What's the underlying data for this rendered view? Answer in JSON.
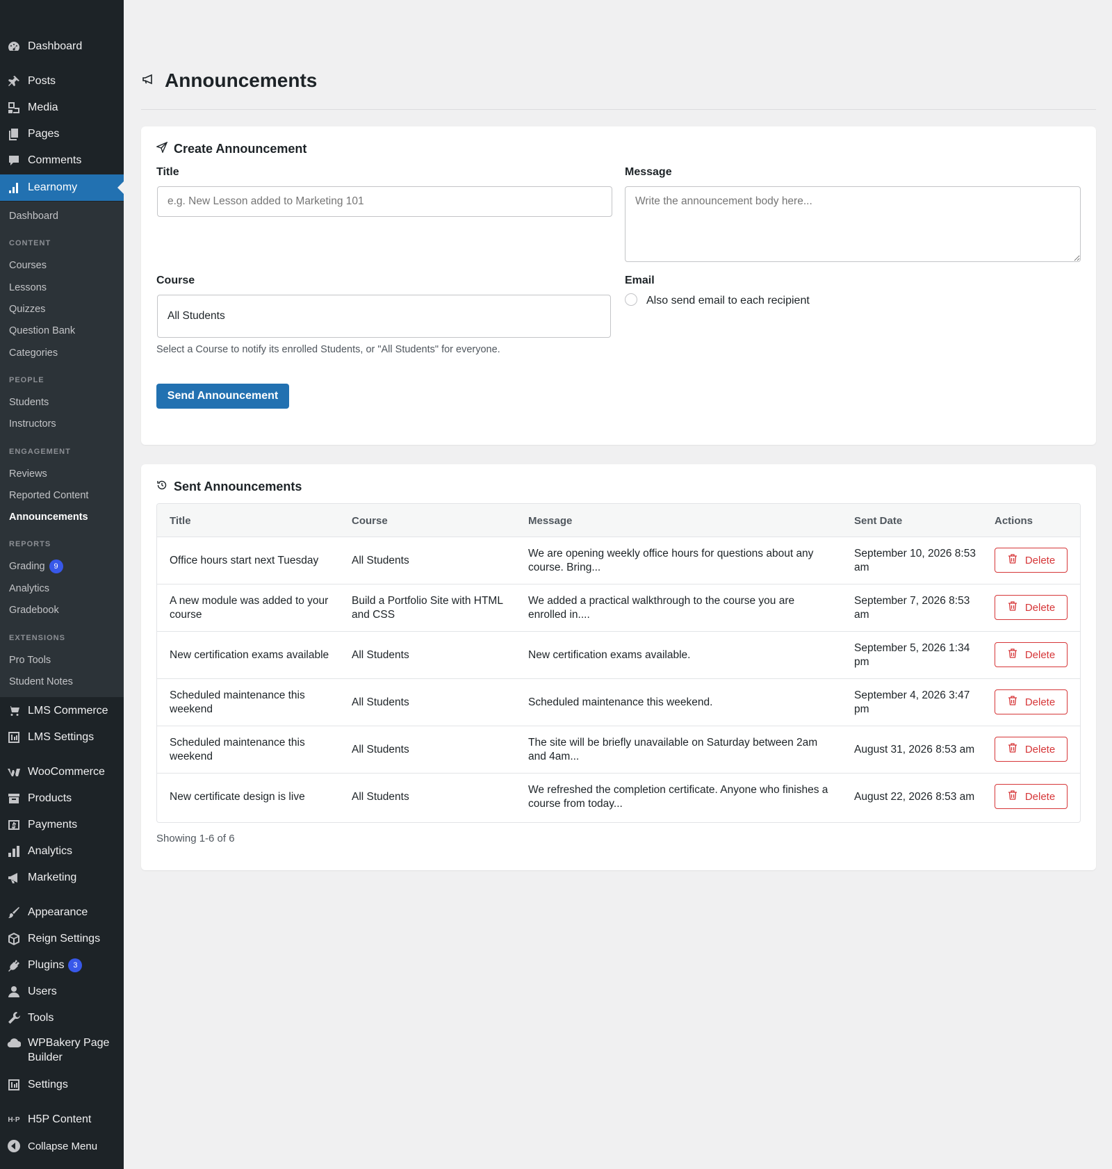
{
  "sidebar": {
    "top_items": [
      {
        "label": "Dashboard",
        "icon": "dashboard-icon"
      },
      {
        "label": "Posts",
        "icon": "pin-icon"
      },
      {
        "label": "Media",
        "icon": "media-icon"
      },
      {
        "label": "Pages",
        "icon": "pages-icon"
      },
      {
        "label": "Comments",
        "icon": "comments-icon"
      },
      {
        "label": "Learnomy",
        "icon": "chart-icon"
      }
    ],
    "submenu": {
      "dashboard": "Dashboard",
      "content_head": "CONTENT",
      "courses": "Courses",
      "lessons": "Lessons",
      "quizzes": "Quizzes",
      "question_bank": "Question Bank",
      "categories": "Categories",
      "people_head": "PEOPLE",
      "students": "Students",
      "instructors": "Instructors",
      "engagement_head": "ENGAGEMENT",
      "reviews": "Reviews",
      "reported_content": "Reported Content",
      "announcements": "Announcements",
      "reports_head": "REPORTS",
      "grading": "Grading",
      "grading_count": "9",
      "analytics": "Analytics",
      "gradebook": "Gradebook",
      "extensions_head": "EXTENSIONS",
      "pro_tools": "Pro Tools",
      "student_notes": "Student Notes"
    },
    "bottom_items": [
      {
        "label": "LMS Commerce",
        "icon": "cart-icon"
      },
      {
        "label": "LMS Settings",
        "icon": "settings-grid-icon"
      },
      {
        "label": "WooCommerce",
        "icon": "woocommerce-icon"
      },
      {
        "label": "Products",
        "icon": "archive-icon"
      },
      {
        "label": "Payments",
        "icon": "dollar-icon"
      },
      {
        "label": "Analytics",
        "icon": "bar-chart-icon"
      },
      {
        "label": "Marketing",
        "icon": "megaphone-icon"
      },
      {
        "label": "Appearance",
        "icon": "brush-icon"
      },
      {
        "label": "Reign Settings",
        "icon": "cube-icon"
      },
      {
        "label": "Plugins",
        "icon": "plug-icon",
        "count": "3"
      },
      {
        "label": "Users",
        "icon": "user-icon"
      },
      {
        "label": "Tools",
        "icon": "wrench-icon"
      },
      {
        "label_line1": "WPBakery Page",
        "label_line2": "Builder",
        "icon": "cloud-icon"
      },
      {
        "label": "Settings",
        "icon": "settings-grid-icon"
      },
      {
        "label": "H5P Content",
        "icon": "h5p-icon"
      },
      {
        "label": "Collapse Menu",
        "icon": "collapse-icon"
      }
    ]
  },
  "page": {
    "title": "Announcements",
    "title_icon": "megaphone-icon"
  },
  "create_form": {
    "heading": "Create Announcement",
    "heading_icon": "send-icon",
    "title_label": "Title",
    "title_placeholder": "e.g. New Lesson added to Marketing 101",
    "title_value": "",
    "message_label": "Message",
    "message_placeholder": "Write the announcement body here...",
    "message_value": "",
    "course_label": "Course",
    "course_selected": "All Students",
    "course_help": "Select a Course to notify its enrolled Students, or \"All Students\" for everyone.",
    "email_label": "Email",
    "email_checkbox_label": "Also send email to each recipient",
    "email_checked": false,
    "submit_label": "Send Announcement"
  },
  "sent": {
    "heading": "Sent Announcements",
    "heading_icon": "history-icon",
    "columns": [
      "Title",
      "Course",
      "Message",
      "Sent Date",
      "Actions"
    ],
    "rows": [
      {
        "title": "Office hours start next Tuesday",
        "course": "All Students",
        "message": "We are opening weekly office hours for questions about any course. Bring...",
        "sent_date": "September 10, 2026 8:53 am",
        "action": "Delete"
      },
      {
        "title": "A new module was added to your course",
        "course": "Build a Portfolio Site with HTML and CSS",
        "message": "We added a practical walkthrough to the course you are enrolled in....",
        "sent_date": "September 7, 2026 8:53 am",
        "action": "Delete"
      },
      {
        "title": "New certification exams available",
        "course": "All Students",
        "message": "New certification exams available.",
        "sent_date": "September 5, 2026 1:34 pm",
        "action": "Delete"
      },
      {
        "title": "Scheduled maintenance this weekend",
        "course": "All Students",
        "message": "Scheduled maintenance this weekend.",
        "sent_date": "September 4, 2026 3:47 pm",
        "action": "Delete"
      },
      {
        "title": "Scheduled maintenance this weekend",
        "course": "All Students",
        "message": "The site will be briefly unavailable on Saturday between 2am and 4am...",
        "sent_date": "August 31, 2026 8:53 am",
        "action": "Delete"
      },
      {
        "title": "New certificate design is live",
        "course": "All Students",
        "message": "We refreshed the completion certificate. Anyone who finishes a course from today...",
        "sent_date": "August 22, 2026 8:53 am",
        "action": "Delete"
      }
    ],
    "pagination_text": "Showing 1-6 of 6"
  },
  "colors": {
    "sidebar_bg": "#1d2327",
    "submenu_bg": "#2c3338",
    "accent": "#2271b1",
    "badge": "#3858e9",
    "danger": "#d63638"
  }
}
